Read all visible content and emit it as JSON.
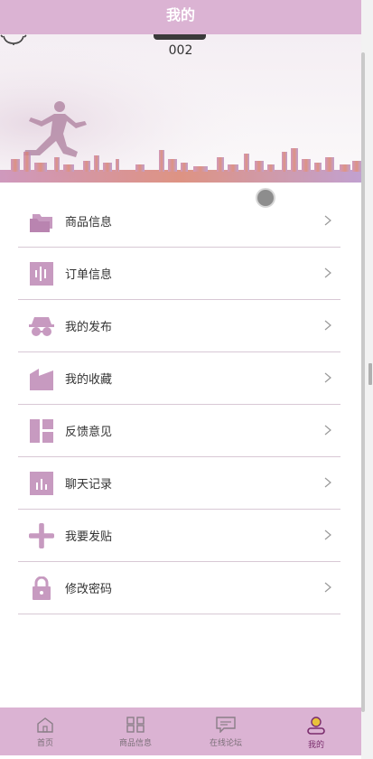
{
  "header": {
    "title": "我的"
  },
  "profile": {
    "username": "002"
  },
  "colors": {
    "accent": "#dbb3d3",
    "icon": "#c79ac0",
    "active": "#7a2d6d"
  },
  "menu": [
    {
      "label": "商品信息",
      "icon": "folder-icon"
    },
    {
      "label": "订单信息",
      "icon": "audio-bars-icon"
    },
    {
      "label": "我的发布",
      "icon": "incognito-icon"
    },
    {
      "label": "我的收藏",
      "icon": "factory-icon"
    },
    {
      "label": "反馈意见",
      "icon": "layout-icon"
    },
    {
      "label": "聊天记录",
      "icon": "bar-chart-icon"
    },
    {
      "label": "我要发贴",
      "icon": "plus-icon"
    },
    {
      "label": "修改密码",
      "icon": "lock-icon"
    }
  ],
  "tabbar": [
    {
      "label": "首页",
      "icon": "home-icon"
    },
    {
      "label": "商品信息",
      "icon": "grid-icon"
    },
    {
      "label": "在线论坛",
      "icon": "message-icon"
    },
    {
      "label": "我的",
      "icon": "user-icon",
      "active": true
    }
  ]
}
